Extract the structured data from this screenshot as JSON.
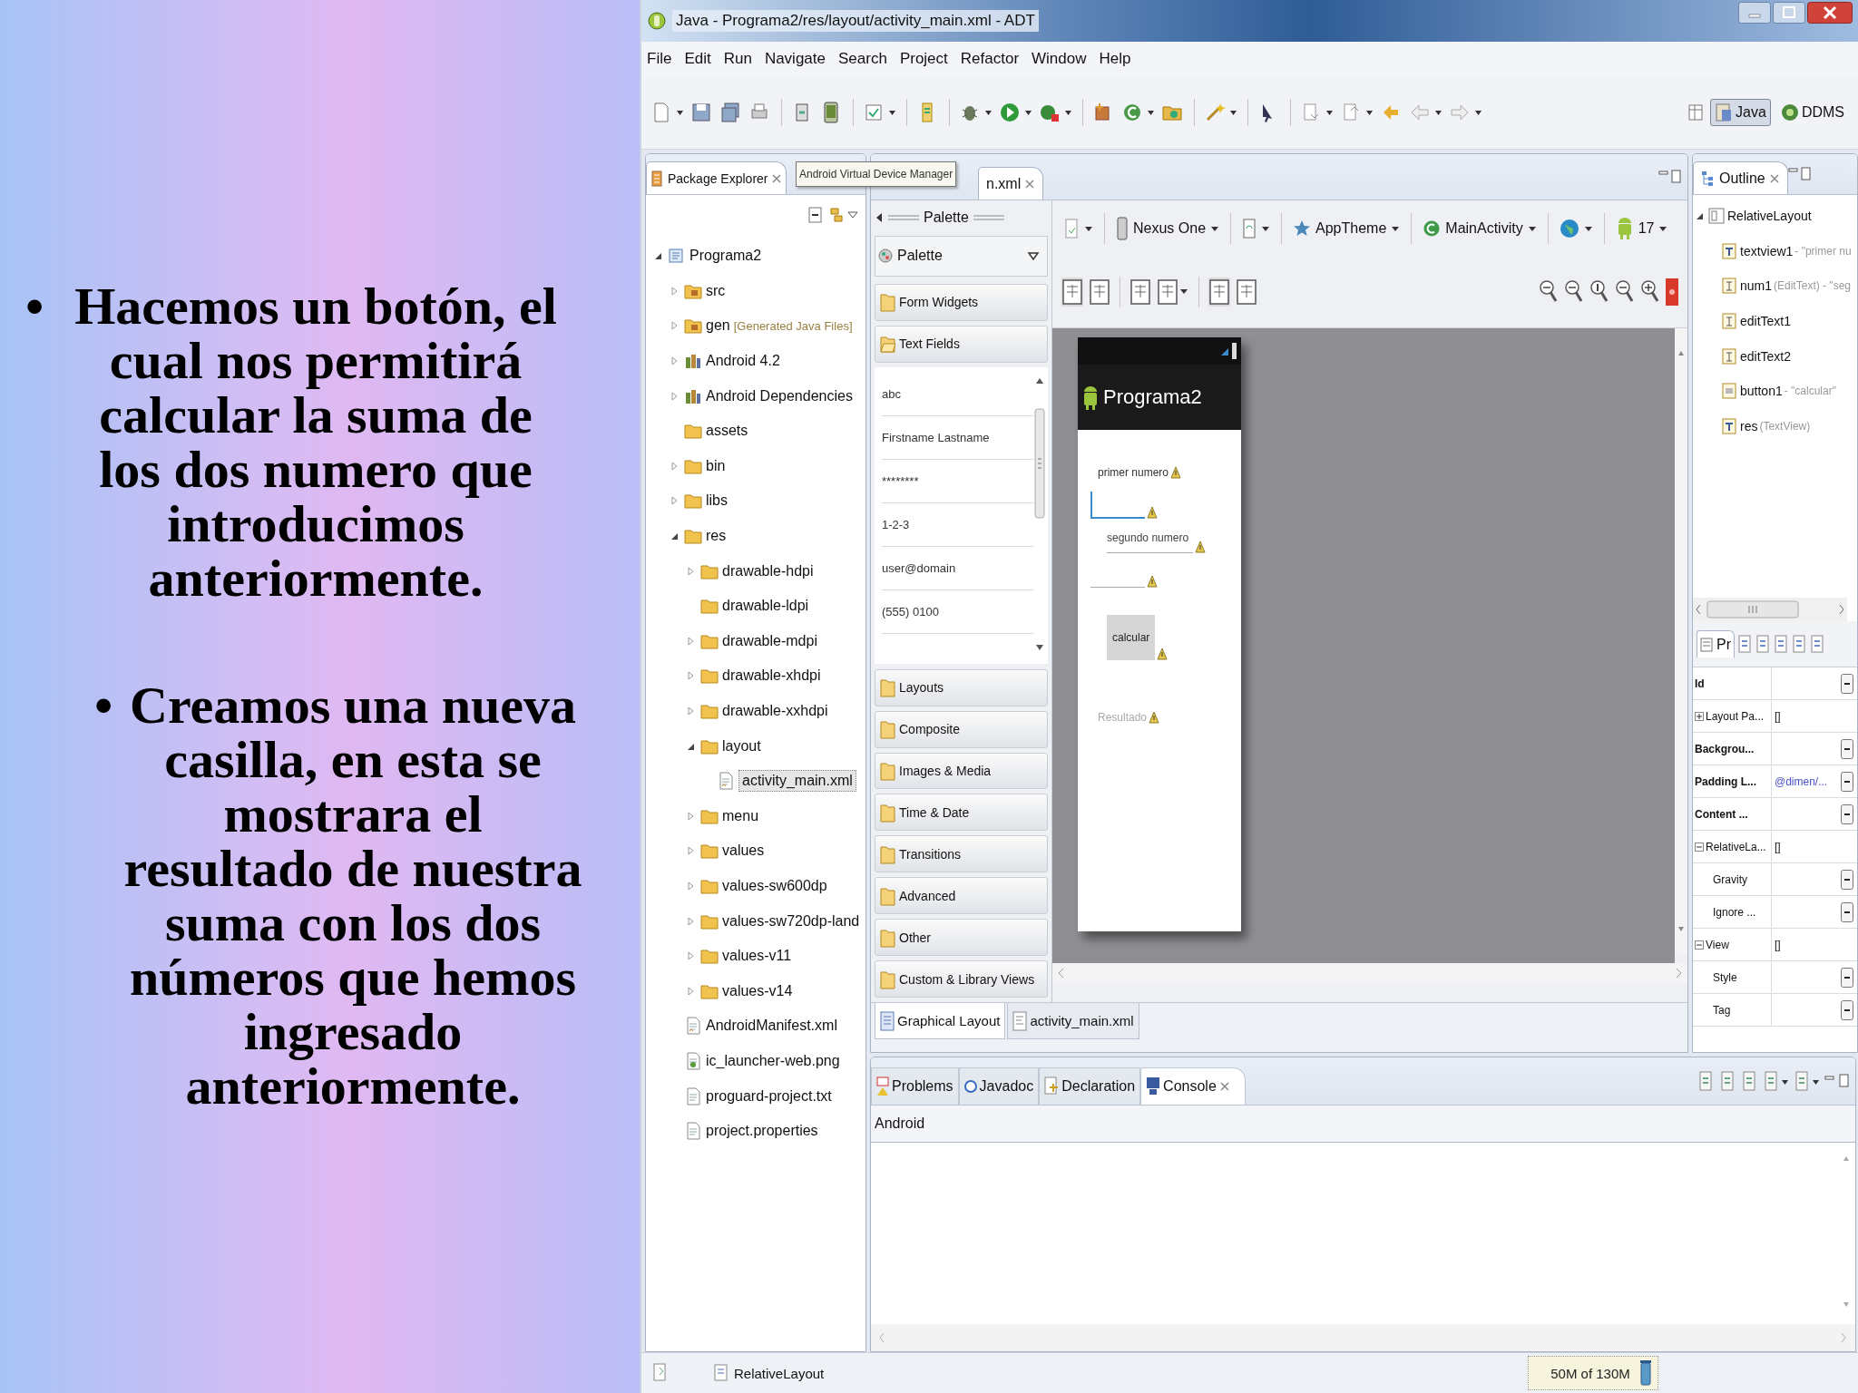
{
  "slide": {
    "bullets": [
      {
        "marker": "•",
        "text": "Hacemos un botón, el cual nos permitirá calcular la suma de los dos numero que introducimos anteriormente."
      },
      {
        "marker": "•",
        "text": "Creamos una nueva casilla, en esta se mostrara el resultado de nuestra suma con los dos números que hemos ingresado anteriormente."
      }
    ]
  },
  "window": {
    "title": "Java - Programa2/res/layout/activity_main.xml - ADT"
  },
  "menu": [
    "File",
    "Edit",
    "Run",
    "Navigate",
    "Search",
    "Project",
    "Refactor",
    "Window",
    "Help"
  ],
  "perspectives": [
    {
      "label": "Java",
      "selected": true
    },
    {
      "label": "DDMS",
      "selected": false
    }
  ],
  "package_explorer": {
    "title": "Package Explorer",
    "tree": [
      {
        "label": "Programa2",
        "kind": "project",
        "expanded": true,
        "children": [
          {
            "label": "src",
            "kind": "source",
            "expanded": false
          },
          {
            "label": "gen",
            "detail": "[Generated Java Files]",
            "kind": "source",
            "expanded": false
          },
          {
            "label": "Android 4.2",
            "kind": "library",
            "expanded": false
          },
          {
            "label": "Android Dependencies",
            "kind": "library",
            "expanded": false
          },
          {
            "label": "assets",
            "kind": "folder"
          },
          {
            "label": "bin",
            "kind": "folder",
            "expanded": false
          },
          {
            "label": "libs",
            "kind": "folder",
            "expanded": false
          },
          {
            "label": "res",
            "kind": "folder",
            "expanded": true,
            "children": [
              {
                "label": "drawable-hdpi",
                "kind": "folder",
                "expanded": false
              },
              {
                "label": "drawable-ldpi",
                "kind": "folder"
              },
              {
                "label": "drawable-mdpi",
                "kind": "folder",
                "expanded": false
              },
              {
                "label": "drawable-xhdpi",
                "kind": "folder",
                "expanded": false
              },
              {
                "label": "drawable-xxhdpi",
                "kind": "folder",
                "expanded": false
              },
              {
                "label": "layout",
                "kind": "folder",
                "expanded": true,
                "children": [
                  {
                    "label": "activity_main.xml",
                    "kind": "xml",
                    "selected": true
                  }
                ]
              },
              {
                "label": "menu",
                "kind": "folder",
                "expanded": false
              },
              {
                "label": "values",
                "kind": "folder",
                "expanded": false
              },
              {
                "label": "values-sw600dp",
                "kind": "folder",
                "expanded": false
              },
              {
                "label": "values-sw720dp-land",
                "kind": "folder",
                "expanded": false
              },
              {
                "label": "values-v11",
                "kind": "folder",
                "expanded": false
              },
              {
                "label": "values-v14",
                "kind": "folder",
                "expanded": false
              }
            ]
          },
          {
            "label": "AndroidManifest.xml",
            "kind": "xml"
          },
          {
            "label": "ic_launcher-web.png",
            "kind": "image"
          },
          {
            "label": "proguard-project.txt",
            "kind": "text"
          },
          {
            "label": "project.properties",
            "kind": "text"
          }
        ]
      }
    ]
  },
  "tooltip": "Android Virtual Device Manager",
  "editor": {
    "tab": "n.xml",
    "palette": {
      "title": "Palette",
      "selector": "Palette",
      "categories": [
        {
          "label": "Form Widgets",
          "expanded": false
        },
        {
          "label": "Text Fields",
          "expanded": true,
          "items": [
            "abc",
            "Firstname Lastname",
            "********",
            "1-2-3",
            "user@domain",
            "(555) 0100"
          ]
        },
        {
          "label": "Layouts",
          "expanded": false
        },
        {
          "label": "Composite",
          "expanded": false
        },
        {
          "label": "Images & Media",
          "expanded": false
        },
        {
          "label": "Time & Date",
          "expanded": false
        },
        {
          "label": "Transitions",
          "expanded": false
        },
        {
          "label": "Advanced",
          "expanded": false
        },
        {
          "label": "Other",
          "expanded": false
        },
        {
          "label": "Custom & Library Views",
          "expanded": false
        }
      ]
    },
    "toolbar": {
      "device": "Nexus One",
      "theme": "AppTheme",
      "activity": "MainActivity",
      "api": "17"
    },
    "phone": {
      "app_title": "Programa2",
      "widgets": [
        {
          "kind": "label",
          "text": "primer numero"
        },
        {
          "kind": "field",
          "focused": true
        },
        {
          "kind": "field",
          "placeholder": "segundo numero",
          "focused": false
        },
        {
          "kind": "field",
          "focused": false
        },
        {
          "kind": "button",
          "text": "calcular"
        },
        {
          "kind": "result",
          "text": "Resultado"
        }
      ]
    },
    "views": [
      {
        "label": "Graphical Layout",
        "selected": true
      },
      {
        "label": "activity_main.xml",
        "selected": false
      }
    ]
  },
  "outline": {
    "title": "Outline",
    "tree": [
      {
        "label": "RelativeLayout",
        "kind": "layout",
        "expanded": true,
        "children": [
          {
            "label": "textview1",
            "detail": " - \"primer nu",
            "kind": "text-view"
          },
          {
            "label": "num1",
            "detail": " (EditText) - \"seg",
            "kind": "edit-text"
          },
          {
            "label": "editText1",
            "kind": "edit-text"
          },
          {
            "label": "editText2",
            "kind": "edit-text"
          },
          {
            "label": "button1",
            "detail": " - \"calcular\"",
            "kind": "button-view"
          },
          {
            "label": "res",
            "detail": " (TextView)",
            "kind": "text-view"
          }
        ]
      }
    ]
  },
  "properties": {
    "title": "Pr",
    "rows": [
      {
        "name": "Id",
        "kind": "prop"
      },
      {
        "name": "Layout Pa...",
        "kind": "group",
        "expanded": false,
        "value": "[]"
      },
      {
        "name": "Backgrou...",
        "kind": "prop"
      },
      {
        "name": "Padding L...",
        "kind": "prop",
        "value": "@dimen/..."
      },
      {
        "name": "Content ...",
        "kind": "prop"
      },
      {
        "name": "RelativeLa...",
        "kind": "group",
        "expanded": true,
        "value": "[]"
      },
      {
        "name": "Gravity",
        "kind": "sub"
      },
      {
        "name": "Ignore ...",
        "kind": "sub"
      },
      {
        "name": "View",
        "kind": "group",
        "expanded": true,
        "value": "[]"
      },
      {
        "name": "Style",
        "kind": "sub"
      },
      {
        "name": "Tag",
        "kind": "sub"
      }
    ]
  },
  "console": {
    "tabs": [
      {
        "label": "Problems",
        "selected": false
      },
      {
        "label": "Javadoc",
        "selected": false
      },
      {
        "label": "Declaration",
        "selected": false
      },
      {
        "label": "Console",
        "selected": true
      }
    ],
    "label": "Android"
  },
  "status_bar": {
    "selection": "RelativeLayout",
    "memory": "50M of 130M"
  }
}
